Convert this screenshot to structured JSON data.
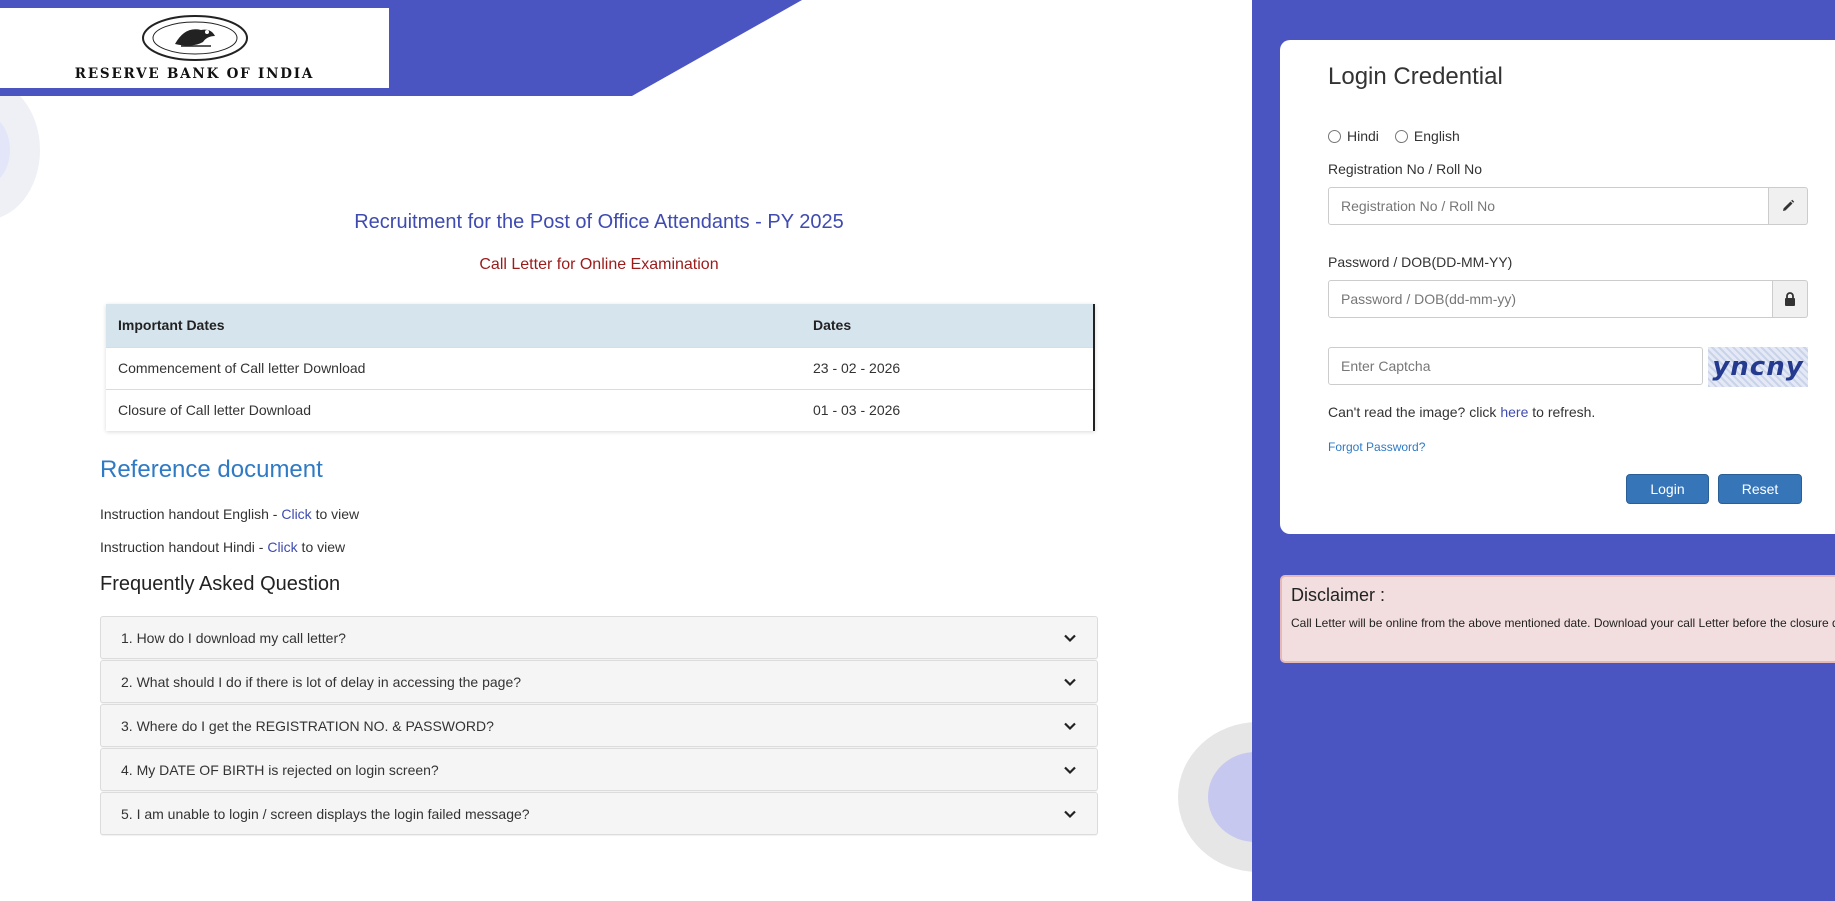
{
  "header": {
    "logo_text": "RESERVE BANK OF INDIA"
  },
  "main": {
    "title": "Recruitment for the Post of Office Attendants - PY 2025",
    "subtitle": "Call Letter for Online Examination",
    "dates_table": {
      "headers": [
        "Important Dates",
        "Dates"
      ],
      "rows": [
        [
          "Commencement of Call letter Download",
          "23 - 02 - 2026"
        ],
        [
          "Closure of Call letter Download",
          "01 - 03 - 2026"
        ]
      ]
    },
    "reference": {
      "heading": "Reference document",
      "items": [
        {
          "prefix": "Instruction handout English - ",
          "link": "Click",
          "suffix": " to view"
        },
        {
          "prefix": "Instruction handout Hindi - ",
          "link": "Click",
          "suffix": " to view"
        }
      ]
    },
    "faq": {
      "heading": "Frequently Asked Question",
      "items": [
        "1. How do I download my call letter?",
        "2. What should I do if there is lot of delay in accessing the page?",
        "3. Where do I get the REGISTRATION NO. & PASSWORD?",
        "4. My DATE OF BIRTH is rejected on login screen?",
        "5. I am unable to login / screen displays the login failed message?"
      ]
    }
  },
  "login": {
    "title": "Login Credential",
    "languages": [
      "Hindi",
      "English"
    ],
    "registration_label": "Registration No / Roll No",
    "registration_placeholder": "Registration No / Roll No",
    "password_label": "Password / DOB(DD-MM-YY)",
    "password_placeholder": "Password / DOB(dd-mm-yy)",
    "captcha_placeholder": "Enter Captcha",
    "captcha_text": "yncny",
    "refresh_prefix": "Can't read the image? click ",
    "refresh_link": "here",
    "refresh_suffix": " to refresh.",
    "forgot_password": "Forgot Password?",
    "login_button": "Login",
    "reset_button": "Reset"
  },
  "disclaimer": {
    "title": "Disclaimer :",
    "text": "Call Letter will be online from the above mentioned date. Download your call Letter before the closure date."
  },
  "colors": {
    "brand": "#4b55c1",
    "title": "#3f4bb0",
    "subtitle": "#9b1b1b",
    "button": "#3676b8"
  }
}
